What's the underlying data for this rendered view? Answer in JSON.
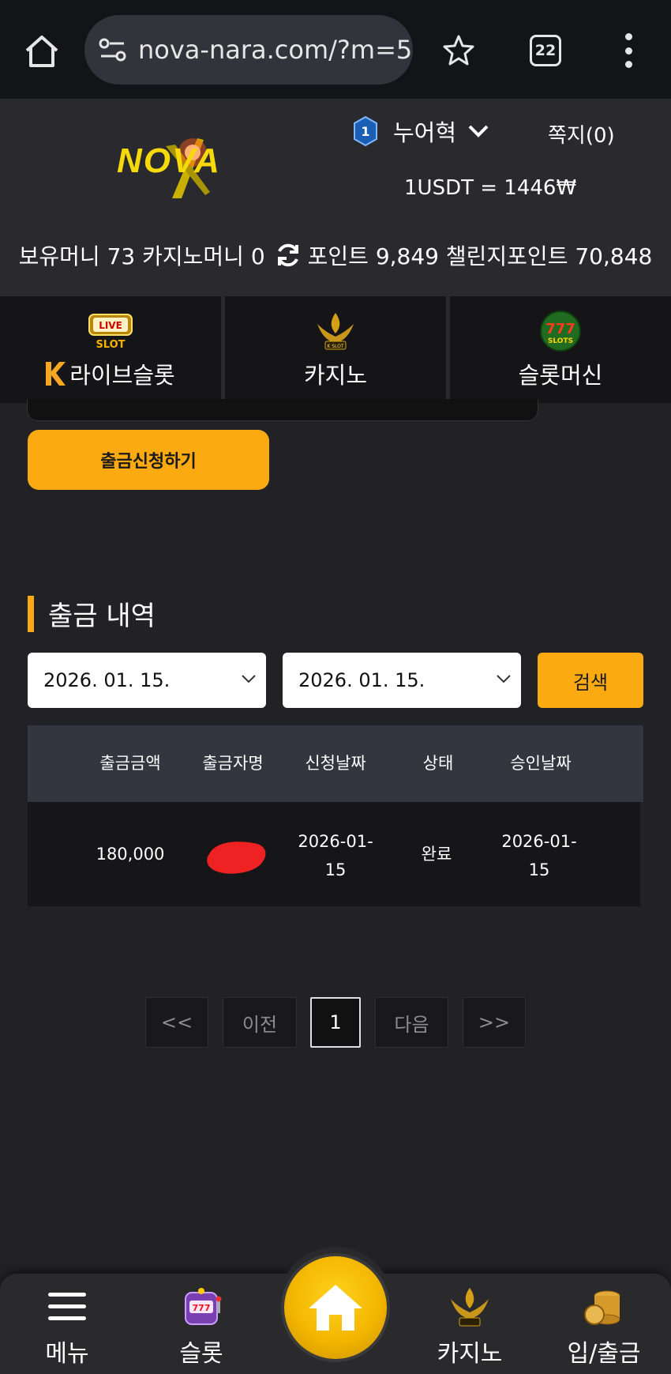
{
  "browser": {
    "url": "nova-nara.com/?m=5",
    "tab_count": "22"
  },
  "header": {
    "logo_text": "NOVA",
    "level": "1",
    "username": "누어혁",
    "messages": "쪽지(0)",
    "exchange_rate": "1USDT = 1446₩",
    "balance": "보유머니 73 카지노머니 0",
    "points": "포인트 9,849 챌린지포인트 70,848"
  },
  "categories": [
    {
      "label": "라이브슬롯",
      "icon": "live-slot-icon"
    },
    {
      "label": "카지노",
      "icon": "k-slot-icon"
    },
    {
      "label": "슬롯머신",
      "icon": "777-slots-icon"
    }
  ],
  "withdraw_button": "출금신청하기",
  "history": {
    "title": "출금 내역",
    "date_from": "2026. 01. 15.",
    "date_to": "2026. 01. 15.",
    "search_label": "검색",
    "columns": [
      "출금금액",
      "출금자명",
      "신청날짜",
      "상태",
      "승인날짜"
    ],
    "rows": [
      {
        "amount": "180,000",
        "name": "",
        "requested_line1": "2026-01-",
        "requested_line2": "15",
        "status": "완료",
        "approved_line1": "2026-01-",
        "approved_line2": "15"
      }
    ]
  },
  "pagination": {
    "first": "<<",
    "prev": "이전",
    "current": "1",
    "next": "다음",
    "last": ">>"
  },
  "bottom_nav": {
    "menu": "메뉴",
    "slot": "슬롯",
    "casino": "카지노",
    "deposit": "입/출금"
  },
  "colors": {
    "accent": "#fbaa12",
    "background": "#222226",
    "header": "#2a2a2e",
    "redaction": "#ee2222"
  }
}
